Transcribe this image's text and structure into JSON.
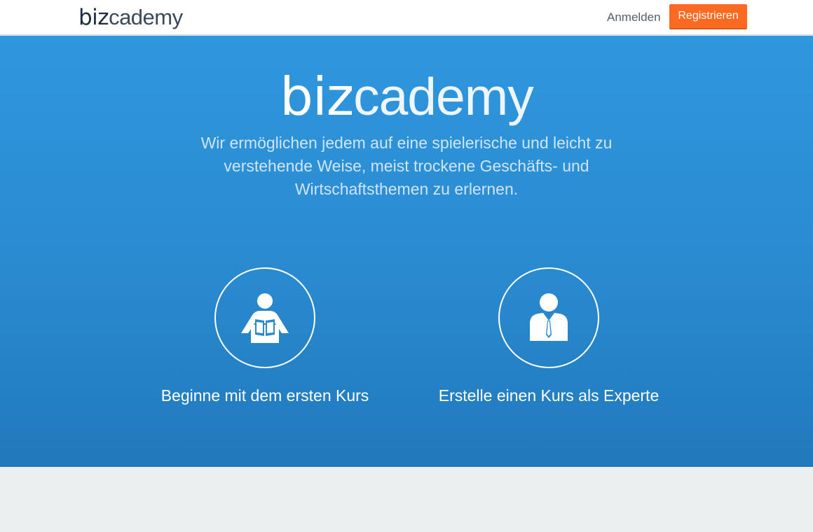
{
  "header": {
    "logo_bold": "biz",
    "logo_light": "cademy",
    "login_label": "Anmelden",
    "register_label": "Registrieren"
  },
  "hero": {
    "logo_bold": "biz",
    "logo_light": "cademy",
    "tagline": "Wir ermöglichen jedem auf eine spielerische und leicht zu verstehende Weise, meist trockene Geschäfts- und Wirtschaftsthemen zu erlernen.",
    "options": [
      {
        "label": "Beginne mit dem ersten Kurs",
        "icon": "reader-icon"
      },
      {
        "label": "Erstelle einen Kurs als Experte",
        "icon": "businessman-icon"
      }
    ]
  },
  "colors": {
    "accent": "#fc6a22",
    "hero_top": "#2f97de",
    "hero_bottom": "#2179bb",
    "footer_bg": "#ebeff0"
  }
}
